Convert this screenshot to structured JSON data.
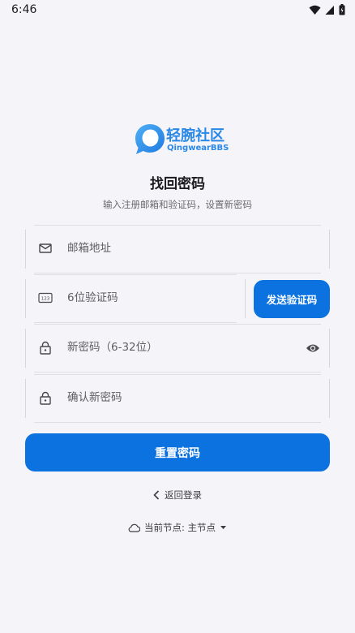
{
  "status_bar": {
    "time": "6:46"
  },
  "logo": {
    "name_cn": "轻腕社区",
    "name_en": "QingwearBBS"
  },
  "title": "找回密码",
  "subtitle": "输入注册邮箱和验证码，设置新密码",
  "form": {
    "email_placeholder": "邮箱地址",
    "code_placeholder": "6位验证码",
    "send_code_label": "发送验证码",
    "new_password_placeholder": "新密码（6-32位）",
    "confirm_password_placeholder": "确认新密码",
    "reset_label": "重置密码"
  },
  "back_label": "返回登录",
  "node": {
    "label": "当前节点: 主节点"
  },
  "colors": {
    "accent": "#0b72e0",
    "logo_blue": "#2a88e6",
    "background": "#f5f4f8"
  }
}
